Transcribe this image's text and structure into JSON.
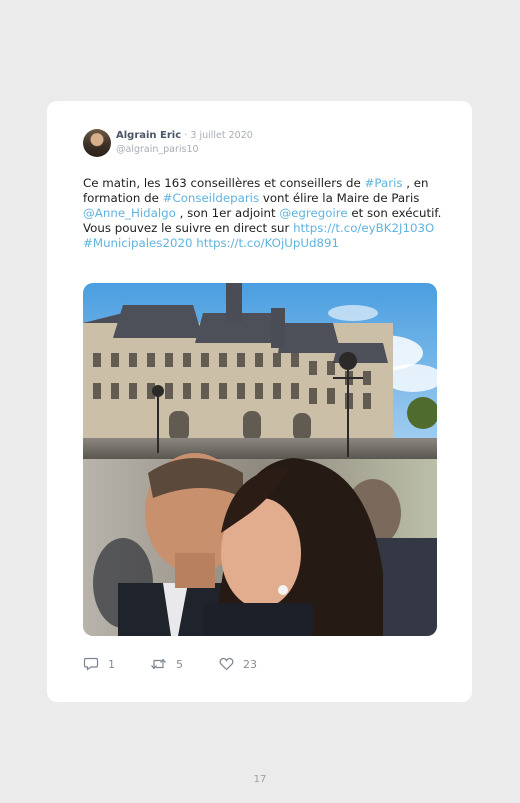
{
  "tweet": {
    "author_name": "Algrain Eric",
    "date": "· 3 juillet 2020",
    "handle": "@algrain_paris10",
    "text_parts": {
      "p1": "Ce matin, les 163 conseillères et conseillers de ",
      "l1": "#Paris",
      "p2": " , en formation de ",
      "l2": "#Conseildeparis",
      "p3": " vont élire la Maire de Paris ",
      "l3": "@Anne_Hidalgo",
      "p4": " , son 1er adjoint ",
      "l4": "@egregoire",
      "p5": " et son exécutif. Vous pouvez le suivre en direct sur ",
      "l5": "https://t.co/eyBK2J103O",
      "p6": " ",
      "l6": "#Municipales2020",
      "p7": " ",
      "l7": "https://t.co/KOjUpUd891"
    },
    "image_icon": "photo-collage-icon",
    "actions": {
      "reply_count": "1",
      "retweet_count": "5",
      "like_count": "23"
    }
  },
  "page": {
    "number": "17"
  },
  "colors": {
    "link": "#5fb3e0",
    "name": "#4a5566",
    "muted": "#a7adb6"
  }
}
